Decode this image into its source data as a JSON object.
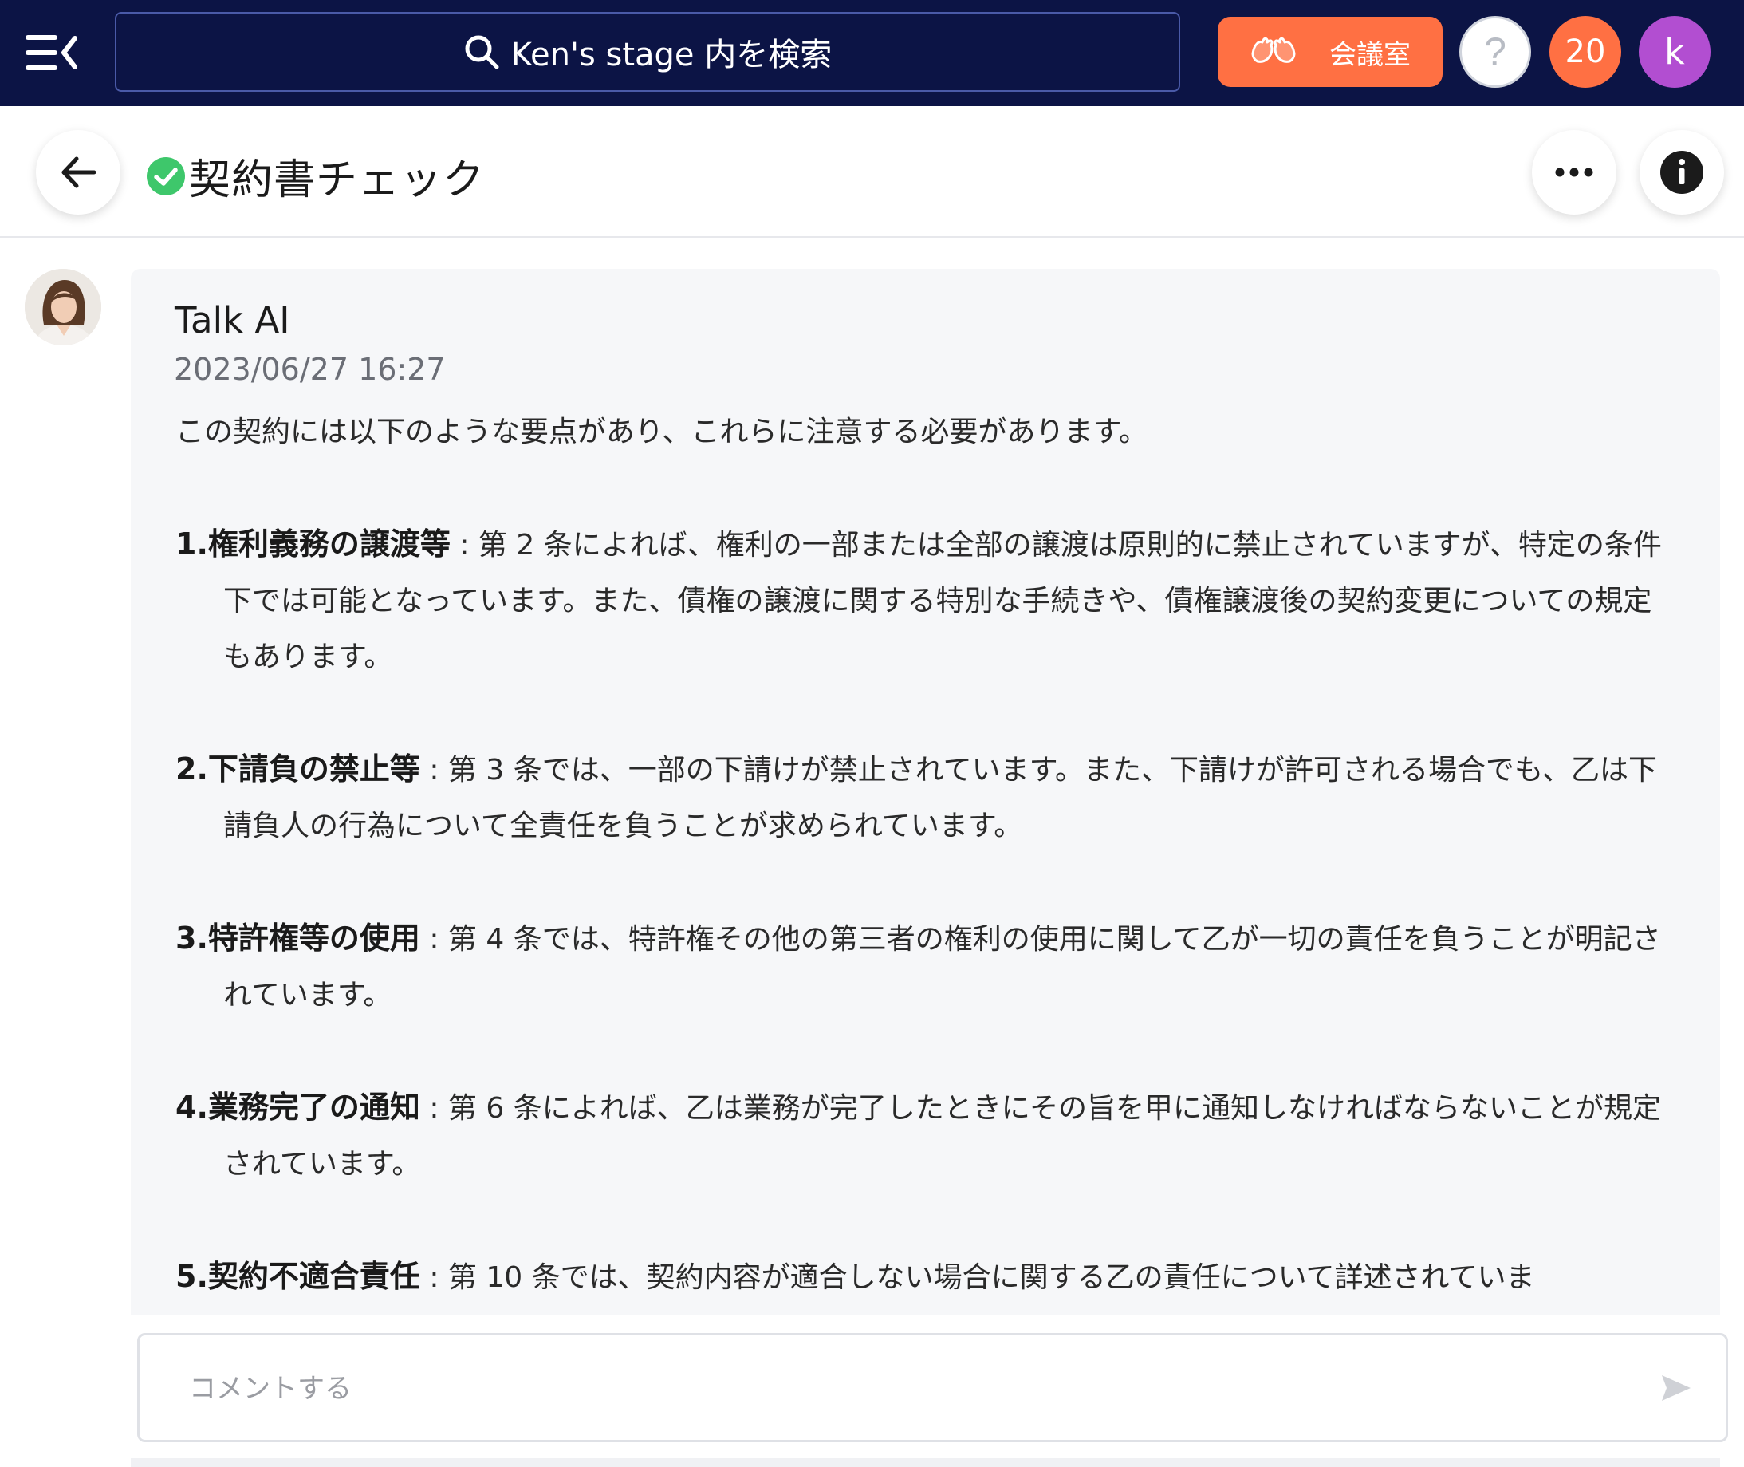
{
  "topbar": {
    "search_text": "Ken's stage 内を検索",
    "meeting_room_label": "会議室",
    "help_label": "?",
    "notification_count": "20",
    "user_initial": "k"
  },
  "header": {
    "title": "契約書チェック"
  },
  "message": {
    "sender": "Talk AI",
    "timestamp": "2023/06/27 16:27",
    "intro": "この契約には以下のような要点があり、これらに注意する必要があります。",
    "points": [
      {
        "num": "1.",
        "title": "権利義務の譲渡等",
        "sep": " : ",
        "text": "第 2 条によれば、権利の一部または全部の譲渡は原則的に禁止されていますが、特定の条件下では可能となっています。また、債権の譲渡に関する特別な手続きや、債権譲渡後の契約変更についての規定もあります。"
      },
      {
        "num": "2.",
        "title": "下請負の禁止等",
        "sep": " : ",
        "text": "第 3 条では、一部の下請けが禁止されています。また、下請けが許可される場合でも、乙は下請負人の行為について全責任を負うことが求められています。"
      },
      {
        "num": "3.",
        "title": "特許権等の使用",
        "sep": " : ",
        "text": "第 4 条では、特許権その他の第三者の権利の使用に関して乙が一切の責任を負うことが明記されています。"
      },
      {
        "num": "4.",
        "title": "業務完了の通知",
        "sep": " : ",
        "text": "第 6 条によれば、乙は業務が完了したときにその旨を甲に通知しなければならないことが規定されています。"
      },
      {
        "num": "5.",
        "title": "契約不適合責任",
        "sep": " : ",
        "text": "第 10 条では、契約内容が適合しない場合に関する乙の責任について詳述されていま"
      }
    ]
  },
  "comment": {
    "placeholder": "コメントする"
  },
  "colors": {
    "topbar_bg": "#0c1445",
    "accent_orange": "#ff7043",
    "avatar_purple": "#b24ed1",
    "check_green": "#3ec76b"
  },
  "icons": {
    "menu": "menu-collapse-icon",
    "search": "search-icon",
    "meeting": "hands-icon",
    "back": "arrow-left-icon",
    "status": "check-circle-icon",
    "more": "more-horizontal-icon",
    "info": "info-icon",
    "send": "send-icon"
  }
}
